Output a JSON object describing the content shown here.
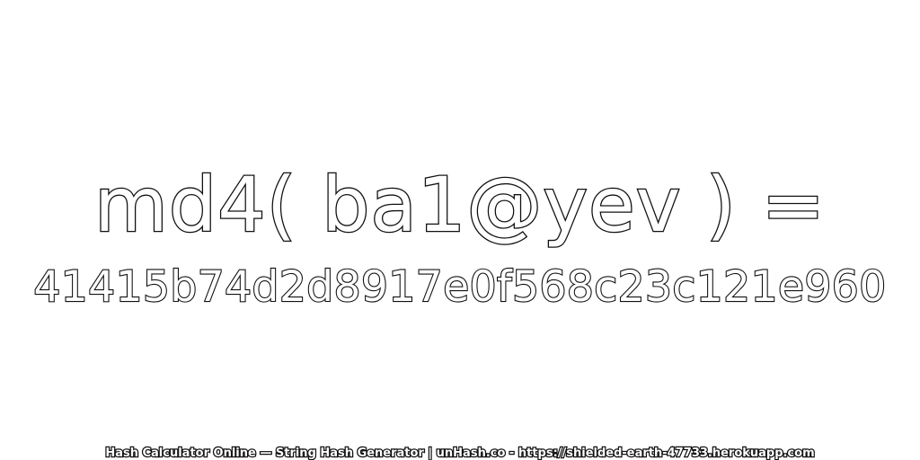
{
  "expression": "md4( ba1@yev ) =",
  "hash_value": "41415b74d2d8917e0f568c23c121e960",
  "footer_text": "Hash Calculator Online — String Hash Generator | unHash.co - https://shielded-earth-47733.herokuapp.com",
  "colors": {
    "background": "#ffffff",
    "text_fill": "#ffffff",
    "text_outline": "#111111"
  }
}
